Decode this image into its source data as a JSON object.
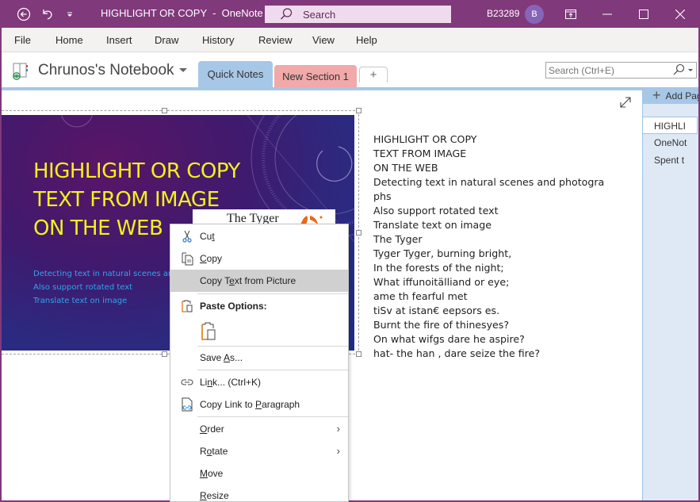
{
  "titlebar": {
    "title": "HIGHLIGHT OR COPY  -  OneNote",
    "search_label": "Search",
    "user": "B23289",
    "avatar_initial": "B",
    "icons": [
      "back-icon",
      "undo-icon",
      "quick-access-dropdown-icon",
      "ribbon-display-icon",
      "minimize-icon",
      "maximize-icon",
      "close-icon"
    ]
  },
  "menu": {
    "items": [
      "File",
      "Home",
      "Insert",
      "Draw",
      "History",
      "Review",
      "View",
      "Help"
    ]
  },
  "notebook": {
    "name": "Chrunos's Notebook",
    "tabs": [
      {
        "label": "Quick Notes",
        "active": true,
        "color": "#a7c7e7"
      },
      {
        "label": "New Section 1",
        "active": false,
        "color": "#f1a9a9"
      }
    ],
    "add_tab_label": "+",
    "search_placeholder": "Search (Ctrl+E)"
  },
  "slide": {
    "title_lines": [
      "HIGHLIGHT OR COPY",
      "TEXT FROM IMAGE",
      "ON THE WEB"
    ],
    "bullets": [
      "Detecting text in natural scenes and photographs",
      "Also support rotated text",
      "Translate text on image"
    ],
    "card_title": "The Tyger"
  },
  "ocr_text": [
    "HIGHLIGHT OR COPY",
    "TEXT FROM IMAGE",
    "ON THE WEB",
    "Detecting text in natural scenes and photogra",
    "phs",
    "Also support rotated text",
    "Translate text on image",
    "The Tyger",
    "Tyger Tyger, burning bright,",
    "In the forests of the night;",
    "What iffunoitälliand or eye;",
    "ame th fearful met",
    "tiSv at istan€ eepsors es.",
    "Burnt the fire of thinesyes?",
    "On what wifgs dare he aspire?",
    "hat- the han , dare seize the fire?"
  ],
  "pages": {
    "add_label": "Add Page",
    "items": [
      {
        "label": "HIGHLI",
        "active": true
      },
      {
        "label": "OneNot",
        "active": false
      },
      {
        "label": "Spent t",
        "active": false
      }
    ]
  },
  "context_menu": {
    "cut": {
      "pre": "Cu",
      "ul": "t",
      "post": ""
    },
    "copy": {
      "pre": "",
      "ul": "C",
      "post": "opy"
    },
    "copy_text": {
      "pre": "Copy T",
      "ul": "e",
      "post": "xt from Picture"
    },
    "paste_header": "Paste Options:",
    "save_as": {
      "pre": "Save ",
      "ul": "A",
      "post": "s..."
    },
    "link": {
      "pre": "Li",
      "ul": "n",
      "post": "k...  (Ctrl+K)"
    },
    "copy_link": {
      "pre": "Copy Link to ",
      "ul": "P",
      "post": "aragraph"
    },
    "order": {
      "pre": "",
      "ul": "O",
      "post": "rder"
    },
    "rotate": {
      "pre": "R",
      "ul": "o",
      "post": "tate"
    },
    "move": {
      "pre": "",
      "ul": "M",
      "post": "ove"
    },
    "resize": {
      "pre": "",
      "ul": "R",
      "post": "esize"
    },
    "submenu_arrow": "›"
  }
}
